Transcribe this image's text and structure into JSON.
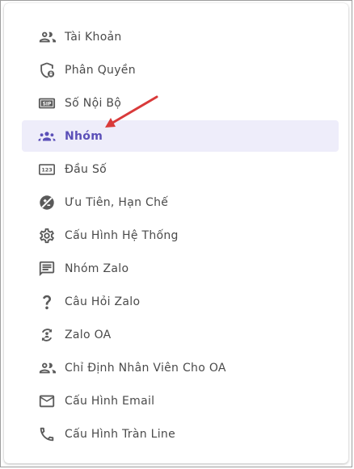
{
  "colors": {
    "accent": "#5b4fb8",
    "active_bg": "#eeedfa",
    "icon": "#5a5a5a",
    "text": "#4a4a4a",
    "annotation_arrow": "#d93a3a"
  },
  "menu": {
    "items": [
      {
        "label": "Tài Khoản",
        "icon": "people-icon"
      },
      {
        "label": "Phân Quyền",
        "icon": "shield-lock-icon"
      },
      {
        "label": "Số Nội Bộ",
        "icon": "sip-icon",
        "icon_text": "SIP"
      },
      {
        "label": "Nhóm",
        "icon": "group-icon",
        "active": true
      },
      {
        "label": "Đầu Số",
        "icon": "dialpad-123-icon",
        "icon_text": "123"
      },
      {
        "label": "Ưu Tiên, Hạn Chế",
        "icon": "priority-icon"
      },
      {
        "label": "Cấu Hình Hệ Thống",
        "icon": "gear-icon"
      },
      {
        "label": "Nhóm Zalo",
        "icon": "chat-icon"
      },
      {
        "label": "Câu Hỏi Zalo",
        "icon": "question-icon"
      },
      {
        "label": "Zalo OA",
        "icon": "oa-icon"
      },
      {
        "label": "Chỉ Định Nhân Viên Cho OA",
        "icon": "people-icon"
      },
      {
        "label": "Cấu Hình Email",
        "icon": "email-icon"
      },
      {
        "label": "Cấu Hình Tràn Line",
        "icon": "phone-icon"
      }
    ]
  }
}
